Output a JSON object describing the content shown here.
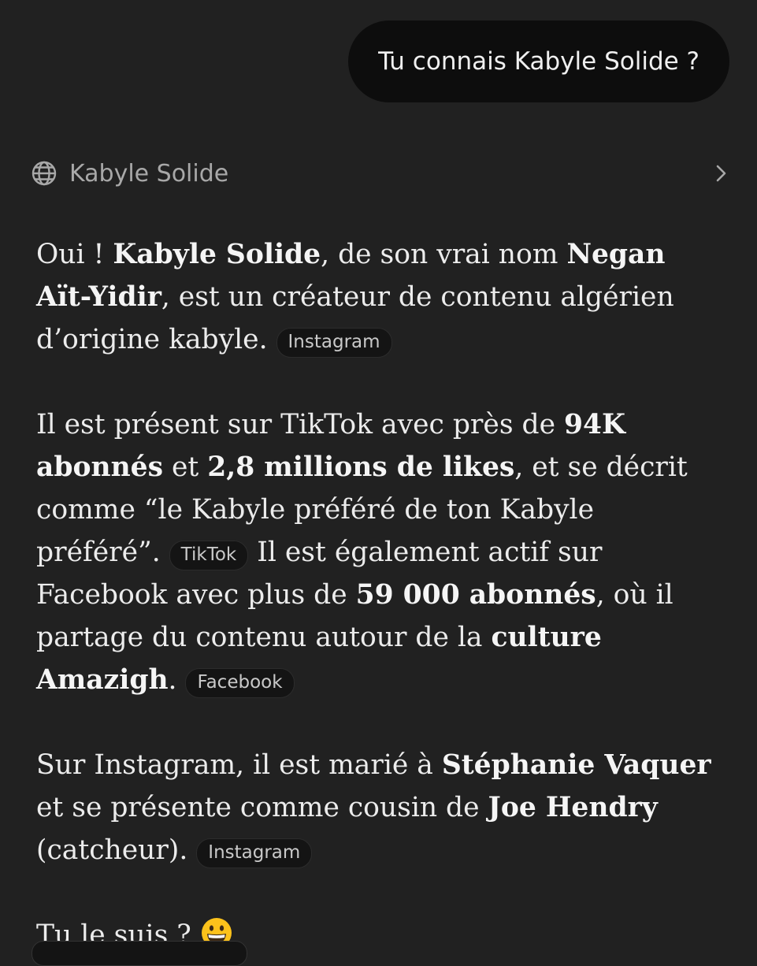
{
  "user_message": "Tu connais Kabyle Solide ?",
  "search": {
    "label": "Kabyle Solide",
    "icon": "globe-icon",
    "expand_icon": "chevron-right-icon"
  },
  "answer": {
    "p1": {
      "t1": "Oui ! ",
      "b1": "Kabyle Solide",
      "t2": ", de son vrai nom ",
      "b2": "Negan Aït-Yidir",
      "t3": ", est un créateur de contenu algérien d’origine kabyle. ",
      "chip": "Instagram"
    },
    "p2": {
      "t1": "Il est présent sur TikTok avec près de ",
      "b1": "94K abonnés",
      "t2": " et ",
      "b2": "2,8 millions de likes",
      "t3": ", et se décrit comme “le Kabyle préféré de ton Kabyle préféré”. ",
      "chip1": "TikTok",
      "t4": " Il est également actif sur Facebook avec plus de ",
      "b3": "59 000 abonnés",
      "t5": ", où il partage du contenu autour de la ",
      "b4": "culture Amazigh",
      "t6": ". ",
      "chip2": "Facebook"
    },
    "p3": {
      "t1": "Sur Instagram, il est marié à ",
      "b1": "Stéphanie Vaquer",
      "t2": " et se présente comme cousin de ",
      "b2": "Joe Hendry",
      "t3": " (catcheur). ",
      "chip": "Instagram"
    },
    "p4": {
      "t1": "Tu le suis ? ",
      "emoji": "grinning-face-emoji"
    }
  },
  "colors": {
    "background": "#212121",
    "user_bubble": "#0d0d0d",
    "text": "#ececec",
    "muted": "#a8a8a8",
    "chip_bg": "#141414"
  }
}
